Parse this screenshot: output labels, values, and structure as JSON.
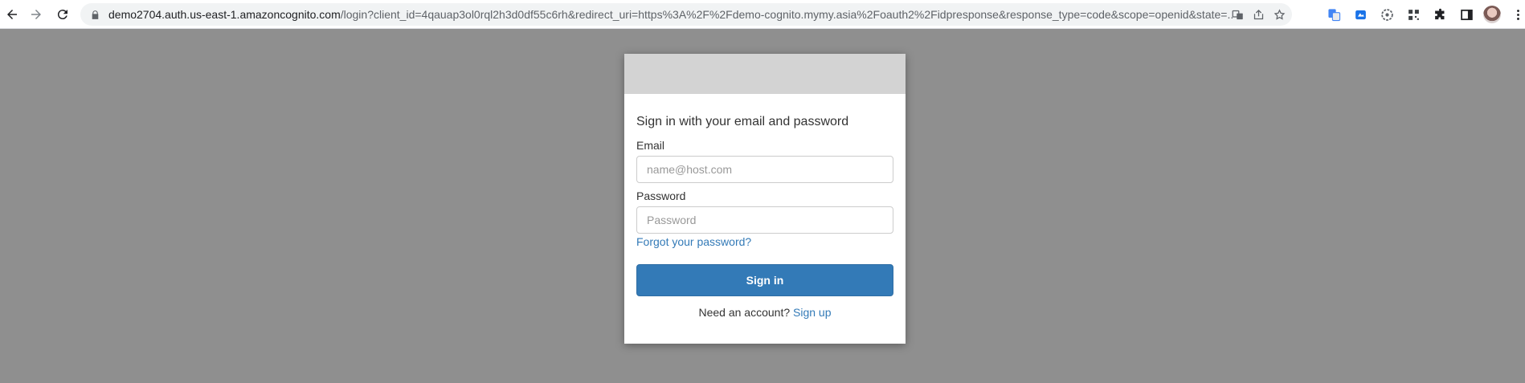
{
  "browser": {
    "url_host": "demo2704.auth.us-east-1.amazoncognito.com",
    "url_rest": "/login?client_id=4qauap3ol0rql2h3d0df55c6rh&redirect_uri=https%3A%2F%2Fdemo-cognito.mymy.asia%2Foauth2%2Fidpresponse&response_type=code&scope=openid&state=...",
    "icons": [
      "back-icon",
      "forward-icon",
      "reload-icon",
      "lock-icon",
      "translate-icon",
      "share-icon",
      "star-icon",
      "google-translate-ext-icon",
      "cast-ext-icon",
      "gear-ext-icon",
      "qr-ext-icon",
      "puzzle-icon",
      "side-panel-icon",
      "avatar",
      "kebab-menu-icon"
    ]
  },
  "signin_form": {
    "heading": "Sign in with your email and password",
    "email_label": "Email",
    "email_placeholder": "name@host.com",
    "password_label": "Password",
    "password_placeholder": "Password",
    "forgot_link": "Forgot your password?",
    "submit_label": "Sign in",
    "account_prompt": "Need an account?",
    "signup_link": "Sign up"
  },
  "colors": {
    "page_overlay": "#8f8f8f",
    "banner": "#d3d3d3",
    "primary": "#337ab7"
  }
}
